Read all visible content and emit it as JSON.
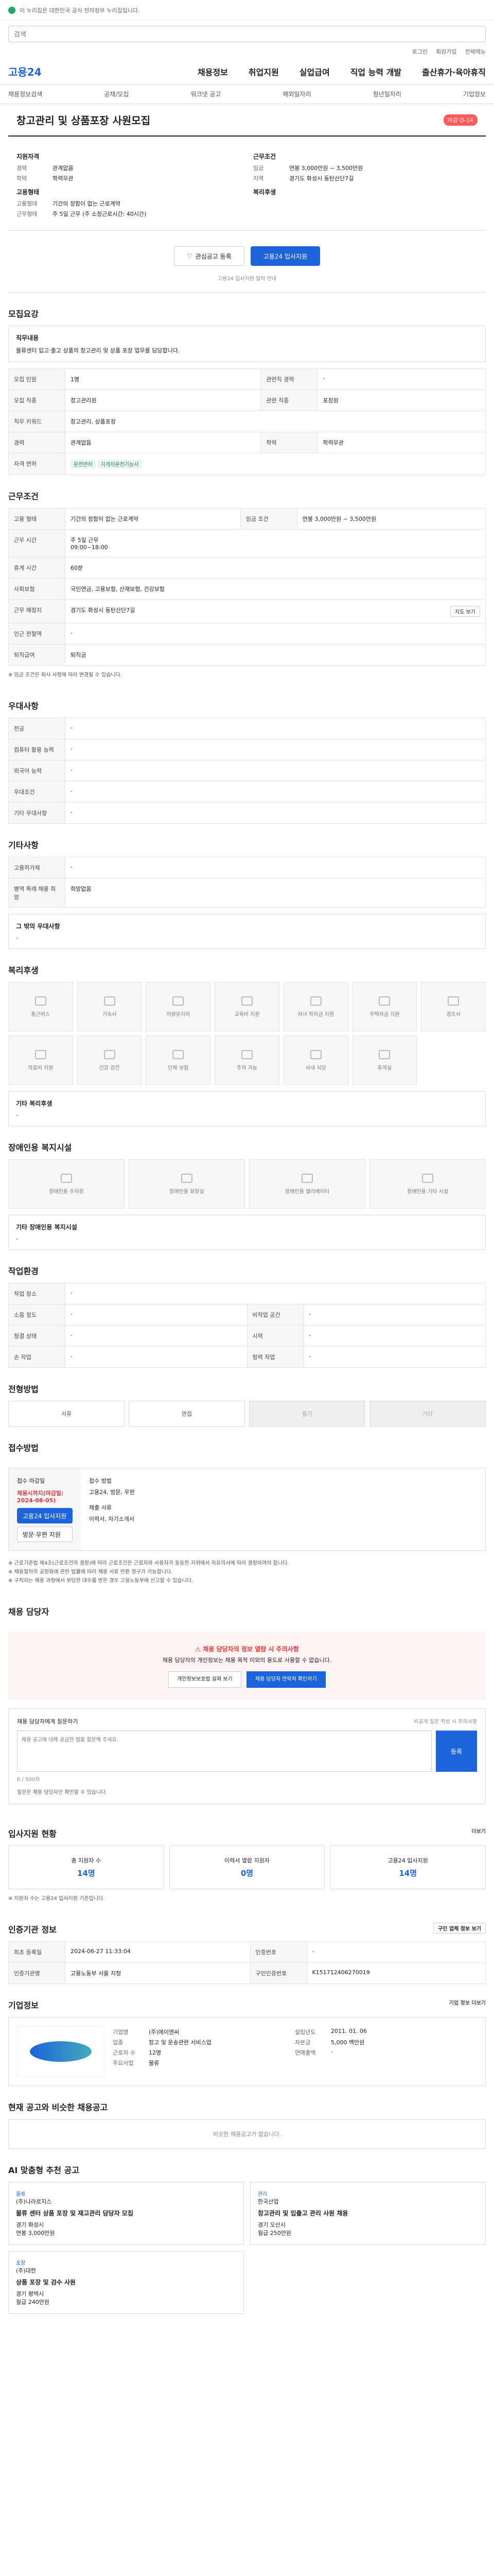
{
  "gov": {
    "banner": "이 누리집은 대한민국 공식 전자정부 누리집입니다."
  },
  "header": {
    "search_placeholder": "검색",
    "utility": [
      "로그인",
      "회원가입",
      "전체메뉴"
    ],
    "logo": "고용24",
    "gnb": [
      "채용정보",
      "취업지원",
      "실업급여",
      "직업 능력 개발",
      "출산휴가·육아휴직"
    ]
  },
  "subnav": [
    "채용정보검색",
    "공채/모집",
    "워크넷 공고",
    "해외일자리",
    "청년일자리",
    "기업정보"
  ],
  "job": {
    "title": "창고관리 및 상품포장 사원모집",
    "dday": "마감 D-14",
    "summary_left_title": "지원자격",
    "summary_right_title": "근무조건",
    "left": [
      {
        "k": "경력",
        "v": "관계없음"
      },
      {
        "k": "학력",
        "v": "학력무관"
      }
    ],
    "left2_title": "고용형태",
    "left2": [
      {
        "k": "고용형태",
        "v": "기간의 정함이 없는 근로계약"
      },
      {
        "k": "근무형태",
        "v": "주 5일 근무 (주 소정근로시간: 40시간)"
      }
    ],
    "right": [
      {
        "k": "임금",
        "v": "연봉 3,000만원 ~ 3,500만원"
      },
      {
        "k": "지역",
        "v": "경기도 화성시 동탄산단7길"
      }
    ],
    "right2_title": "복리후생"
  },
  "actions": {
    "scrap": "관심공고 등록",
    "apply": "고용24 입사지원"
  },
  "notice": "고용24 입사지원 절차 안내",
  "sections": {
    "recruit": "모집요강",
    "conditions": "근무조건",
    "prefer": "우대사항",
    "other": "기타사항",
    "welfare": "복리후생",
    "disabled": "장애인용 복지시설",
    "env": "작업환경",
    "method": "전형방법",
    "apply": "접수방법",
    "contact": "채용 담당자",
    "questions": "채용 담당자에게 질문하기",
    "stats": "입사지원 현황",
    "info": "인증기관 정보",
    "company": "기업정보",
    "recommend": "현재 공고와 비슷한 채용공고",
    "ai": "맞춤형 추천 공고"
  },
  "recruit": {
    "box_title": "직무내용",
    "box_text": "물류센터 입고·출고 상품의 창고관리 및 상품 포장 업무를 담당합니다.",
    "rows": [
      {
        "k": "모집 인원",
        "v": "1명"
      },
      {
        "k": "모집 직종",
        "v": "창고관리원"
      },
      {
        "k": "직무 키워드",
        "v": "창고관리, 상품포장"
      },
      {
        "k": "경력",
        "v": "관계없음"
      },
      {
        "k": "자격 면허",
        "v": "관계없음"
      }
    ],
    "rows_right": [
      {
        "k": "관련직 경력",
        "v": "-"
      },
      {
        "k": "관련 직종",
        "v": "포장원"
      },
      {
        "k": "학력",
        "v": "학력무관"
      }
    ],
    "pills": [
      "운전면허",
      "지게차운전기능사"
    ]
  },
  "conditions": {
    "rows": [
      {
        "k": "고용 형태",
        "v": "기간의 정함이 없는 근로계약"
      },
      {
        "k": "근무 시간",
        "v": "주 5일 근무 (주 소정근로시간: 40시간)"
      },
      {
        "k": "휴게 시간",
        "v": "60분"
      },
      {
        "k": "사회보험",
        "v": "국민연금, 고용보험, 산재보험, 건강보험"
      },
      {
        "k": "근무 예정지",
        "v": "경기도 화성시 동탄산단7길"
      },
      {
        "k": "인근 전철역",
        "v": "-"
      },
      {
        "k": "퇴직급여",
        "v": "퇴직금"
      }
    ],
    "wage": "연봉 3,000만원 ~ 3,500만원",
    "wage_label": "임금 조건",
    "work_week": "주 5일 근무",
    "hours": "09:00~18:00",
    "map_btn": "지도 보기",
    "footnote": "※ 임금 조건은 회사 사정에 따라 변경될 수 있습니다."
  },
  "prefer": {
    "rows": [
      {
        "k": "전공",
        "v": "-"
      },
      {
        "k": "컴퓨터 활용 능력",
        "v": "-"
      },
      {
        "k": "외국어 능력",
        "v": "-"
      },
      {
        "k": "우대조건",
        "v": "-"
      },
      {
        "k": "기타 우대사항",
        "v": "-"
      }
    ]
  },
  "other": {
    "rows": [
      {
        "k": "고용허가제",
        "v": "-"
      },
      {
        "k": "병역 특례 채용 희망",
        "v": "희망없음"
      }
    ],
    "box_title": "그 밖의 우대사항",
    "box_text": "-"
  },
  "welfare": {
    "items": [
      "통근버스",
      "기숙사",
      "차량유지비",
      "교육비 지원",
      "자녀 학자금 지원",
      "주택자금 지원",
      "경조사",
      "의료비 지원",
      "건강 검진",
      "단체 보험",
      "주차 가능",
      "사내 식당",
      "휴게실"
    ],
    "box_title": "기타 복리후생",
    "box_text": "-"
  },
  "disabled": {
    "items": [
      "장애인용 주차장",
      "장애인용 화장실",
      "장애인용 엘리베이터",
      "장애인용 기타 시설"
    ],
    "box_title": "기타 장애인용 복지시설",
    "box_text": "-"
  },
  "env": {
    "rows": [
      {
        "k": "작업 장소",
        "v": "-"
      },
      {
        "k": "소음 정도",
        "v": "-"
      },
      {
        "k": "청결 상태",
        "v": "-"
      },
      {
        "k": "손 작업",
        "v": "-"
      }
    ],
    "rows_right": [
      {
        "k": "비작업 공간",
        "v": "-"
      },
      {
        "k": "시력",
        "v": "-"
      },
      {
        "k": "청력 작업",
        "v": "-"
      }
    ]
  },
  "method": {
    "items": [
      "서류",
      "면접",
      "필기",
      "기타"
    ]
  },
  "apply": {
    "left_title": "접수 마감일",
    "deadline": "채용시까지(마감일: 2024-08-05)",
    "apply_btn": "고용24 입사지원",
    "post_btn": "방문·우편 지원",
    "right_title": "접수 방법",
    "methods": "고용24, 방문, 우편",
    "docs_title": "제출 서류",
    "docs": "이력서, 자기소개서"
  },
  "bullets": [
    "※ 근로기준법 제4조(근로조건의 결정)에 따라 근로조건은 근로자와 사용자가 동등한 지위에서 자유의사에 따라 결정하여야 합니다.",
    "※ 채용절차의 공정화에 관한 법률에 따라 채용 서류 반환 청구가 가능합니다.",
    "※ 구직자는 채용 과정에서 부당한 대우를 받은 경우 고용노동부에 신고할 수 있습니다."
  ],
  "alert": {
    "title": "채용 담당자의 정보 열람 시 주의사항",
    "text": "채용 담당자의 개인정보는 채용 목적 이외의 용도로 사용할 수 없습니다.",
    "btn1": "개인정보보호법 살펴 보기",
    "btn2": "채용 담당자 연락처 확인하기"
  },
  "questions": {
    "head": "채용 담당자에게 질문하기",
    "note": "비공개 질문 작성 시 주의사항",
    "placeholder": "채용 공고에 대해 궁금한 점을 질문해 주세요.",
    "count": "0 / 500자",
    "submit": "등록",
    "foot": "질문은 채용 담당자만 확인할 수 있습니다."
  },
  "stats": {
    "more": "더보기",
    "items": [
      {
        "label": "총 지원자 수",
        "value": "14명"
      },
      {
        "label": "이력서 열람 지원자",
        "value": "0명"
      },
      {
        "label": "고용24 입사지원",
        "value": "14명"
      }
    ],
    "note": "※ 지원자 수는 고용24 입사지원 기준입니다."
  },
  "info": {
    "rows": [
      {
        "k": "최초 등록일",
        "v": "2024-06-27 11:33:04"
      },
      {
        "k": "인증기관명",
        "v": "고용노동부 서울 지청"
      }
    ],
    "rows_right": [
      {
        "k": "인증번호",
        "v": "-"
      },
      {
        "k": "구인인증번호",
        "v": "K151712406270019"
      }
    ],
    "btn": "구인 업체 정보 보기"
  },
  "company": {
    "rows": [
      {
        "k": "기업명",
        "v": "(주)에이엔씨"
      },
      {
        "k": "업종",
        "v": "창고 및 운송관련 서비스업"
      },
      {
        "k": "근로자 수",
        "v": "12명"
      },
      {
        "k": "주요사업",
        "v": "물류"
      }
    ],
    "rows_right": [
      {
        "k": "설립년도",
        "v": "2011. 01. 06"
      },
      {
        "k": "자본금",
        "v": "5,000 백만원"
      },
      {
        "k": "연매출액",
        "v": "-"
      }
    ],
    "more": "기업 정보 더보기"
  },
  "recommend": {
    "text": "비슷한 채용공고가 없습니다."
  },
  "ai": {
    "title": "AI 맞춤형 추천 공고",
    "cards": [
      {
        "tag": "물류",
        "company": "(주)나라로지스",
        "title": "물류 센터 상품 포장 및 재고관리 담당자 모집",
        "loc": "경기 화성시",
        "wage": "연봉 3,000만원"
      },
      {
        "tag": "관리",
        "company": "한국산업",
        "title": "창고관리 및 입출고 관리 사원 채용",
        "loc": "경기 오산시",
        "wage": "월급 250만원"
      },
      {
        "tag": "포장",
        "company": "(주)대한",
        "title": "상품 포장 및 검수 사원",
        "loc": "경기 평택시",
        "wage": "월급 240만원"
      }
    ]
  }
}
